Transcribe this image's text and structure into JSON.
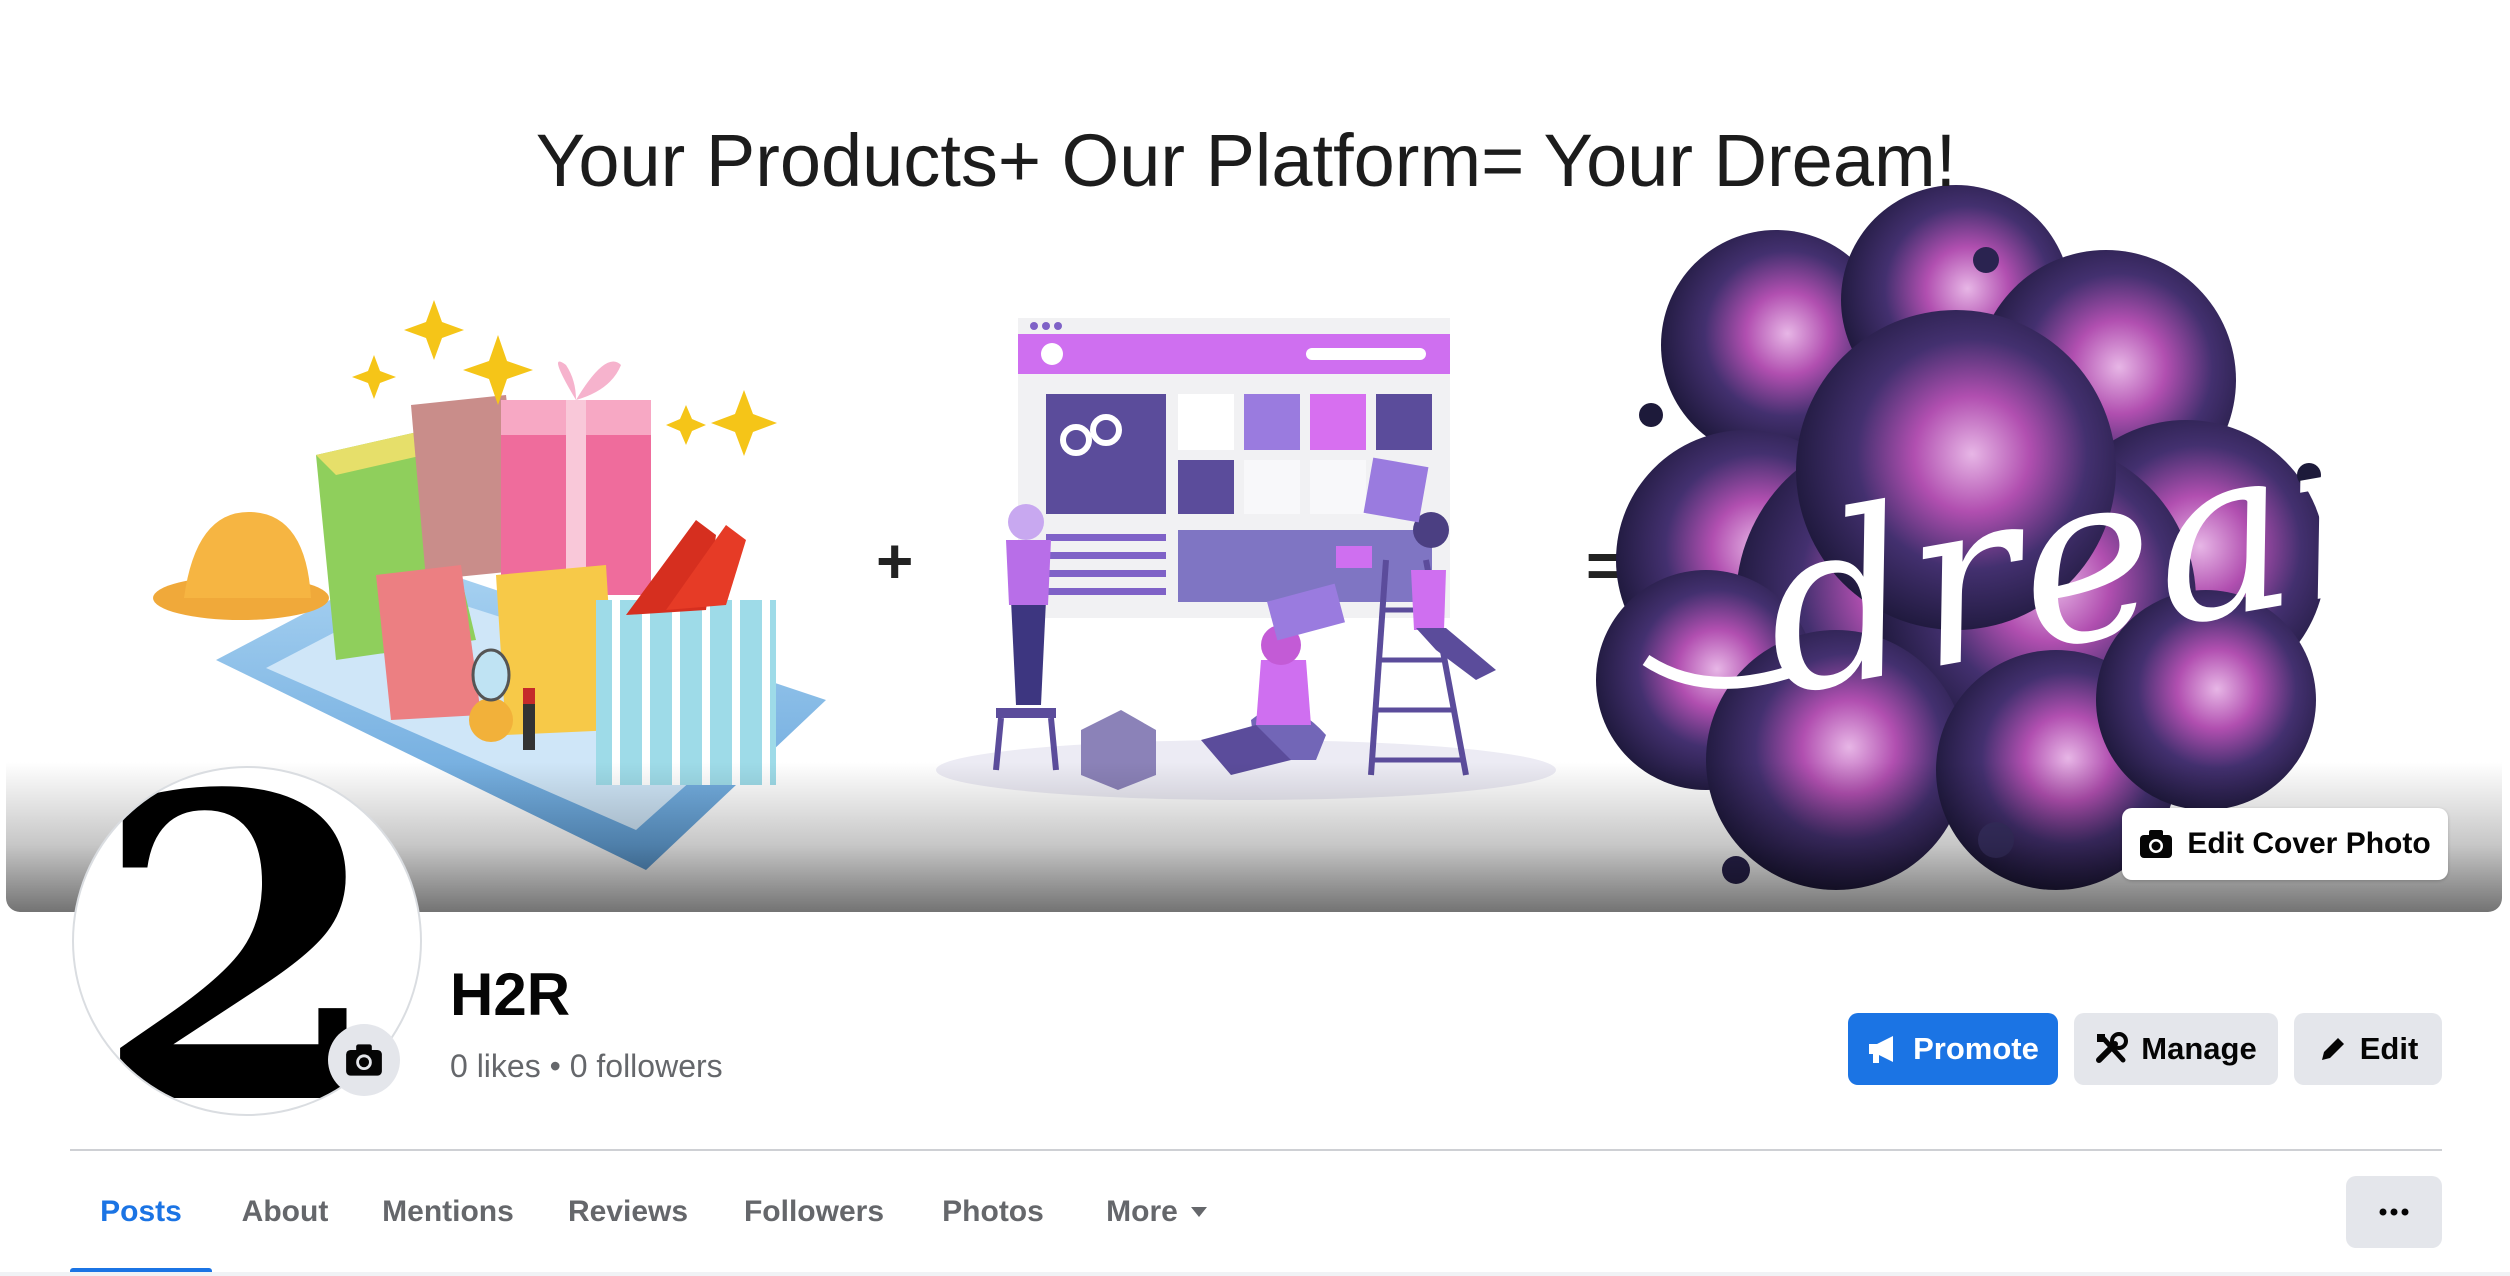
{
  "cover": {
    "headline": "Your Products+ Our Platform= Your Dream!",
    "art_text": "dreams",
    "plus_sign": "+",
    "equals_sign": "=",
    "edit_cover_label": "Edit Cover Photo"
  },
  "profile": {
    "avatar_text": "2",
    "name": "H2R",
    "stats": "0 likes • 0 followers"
  },
  "actions": {
    "promote": "Promote",
    "manage": "Manage",
    "edit": "Edit"
  },
  "tabs": [
    {
      "label": "Posts",
      "active": true
    },
    {
      "label": "About"
    },
    {
      "label": "Mentions"
    },
    {
      "label": "Reviews"
    },
    {
      "label": "Followers"
    },
    {
      "label": "Photos"
    },
    {
      "label": "More"
    }
  ],
  "colors": {
    "accent": "#1b74e4",
    "button_gray": "#e4e6eb",
    "text_secondary": "#65676b"
  },
  "icons": [
    "camera-icon",
    "megaphone-icon",
    "tools-icon",
    "pencil-icon",
    "caret-down-icon",
    "more-dots-icon"
  ]
}
